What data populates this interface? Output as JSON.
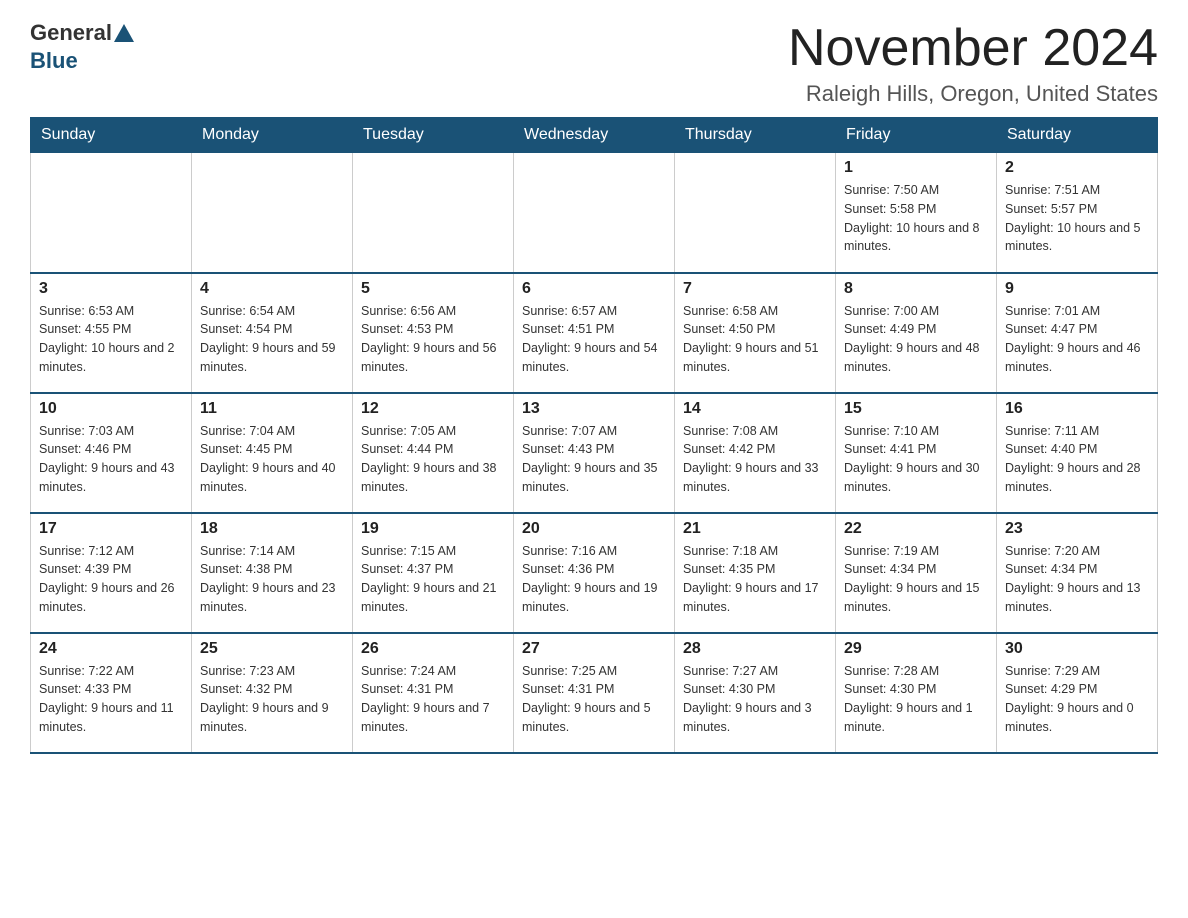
{
  "header": {
    "logo_general": "General",
    "logo_blue": "Blue",
    "month_title": "November 2024",
    "location": "Raleigh Hills, Oregon, United States"
  },
  "weekdays": [
    "Sunday",
    "Monday",
    "Tuesday",
    "Wednesday",
    "Thursday",
    "Friday",
    "Saturday"
  ],
  "weeks": [
    {
      "days": [
        {
          "number": "",
          "info": ""
        },
        {
          "number": "",
          "info": ""
        },
        {
          "number": "",
          "info": ""
        },
        {
          "number": "",
          "info": ""
        },
        {
          "number": "",
          "info": ""
        },
        {
          "number": "1",
          "info": "Sunrise: 7:50 AM\nSunset: 5:58 PM\nDaylight: 10 hours and 8 minutes."
        },
        {
          "number": "2",
          "info": "Sunrise: 7:51 AM\nSunset: 5:57 PM\nDaylight: 10 hours and 5 minutes."
        }
      ]
    },
    {
      "days": [
        {
          "number": "3",
          "info": "Sunrise: 6:53 AM\nSunset: 4:55 PM\nDaylight: 10 hours and 2 minutes."
        },
        {
          "number": "4",
          "info": "Sunrise: 6:54 AM\nSunset: 4:54 PM\nDaylight: 9 hours and 59 minutes."
        },
        {
          "number": "5",
          "info": "Sunrise: 6:56 AM\nSunset: 4:53 PM\nDaylight: 9 hours and 56 minutes."
        },
        {
          "number": "6",
          "info": "Sunrise: 6:57 AM\nSunset: 4:51 PM\nDaylight: 9 hours and 54 minutes."
        },
        {
          "number": "7",
          "info": "Sunrise: 6:58 AM\nSunset: 4:50 PM\nDaylight: 9 hours and 51 minutes."
        },
        {
          "number": "8",
          "info": "Sunrise: 7:00 AM\nSunset: 4:49 PM\nDaylight: 9 hours and 48 minutes."
        },
        {
          "number": "9",
          "info": "Sunrise: 7:01 AM\nSunset: 4:47 PM\nDaylight: 9 hours and 46 minutes."
        }
      ]
    },
    {
      "days": [
        {
          "number": "10",
          "info": "Sunrise: 7:03 AM\nSunset: 4:46 PM\nDaylight: 9 hours and 43 minutes."
        },
        {
          "number": "11",
          "info": "Sunrise: 7:04 AM\nSunset: 4:45 PM\nDaylight: 9 hours and 40 minutes."
        },
        {
          "number": "12",
          "info": "Sunrise: 7:05 AM\nSunset: 4:44 PM\nDaylight: 9 hours and 38 minutes."
        },
        {
          "number": "13",
          "info": "Sunrise: 7:07 AM\nSunset: 4:43 PM\nDaylight: 9 hours and 35 minutes."
        },
        {
          "number": "14",
          "info": "Sunrise: 7:08 AM\nSunset: 4:42 PM\nDaylight: 9 hours and 33 minutes."
        },
        {
          "number": "15",
          "info": "Sunrise: 7:10 AM\nSunset: 4:41 PM\nDaylight: 9 hours and 30 minutes."
        },
        {
          "number": "16",
          "info": "Sunrise: 7:11 AM\nSunset: 4:40 PM\nDaylight: 9 hours and 28 minutes."
        }
      ]
    },
    {
      "days": [
        {
          "number": "17",
          "info": "Sunrise: 7:12 AM\nSunset: 4:39 PM\nDaylight: 9 hours and 26 minutes."
        },
        {
          "number": "18",
          "info": "Sunrise: 7:14 AM\nSunset: 4:38 PM\nDaylight: 9 hours and 23 minutes."
        },
        {
          "number": "19",
          "info": "Sunrise: 7:15 AM\nSunset: 4:37 PM\nDaylight: 9 hours and 21 minutes."
        },
        {
          "number": "20",
          "info": "Sunrise: 7:16 AM\nSunset: 4:36 PM\nDaylight: 9 hours and 19 minutes."
        },
        {
          "number": "21",
          "info": "Sunrise: 7:18 AM\nSunset: 4:35 PM\nDaylight: 9 hours and 17 minutes."
        },
        {
          "number": "22",
          "info": "Sunrise: 7:19 AM\nSunset: 4:34 PM\nDaylight: 9 hours and 15 minutes."
        },
        {
          "number": "23",
          "info": "Sunrise: 7:20 AM\nSunset: 4:34 PM\nDaylight: 9 hours and 13 minutes."
        }
      ]
    },
    {
      "days": [
        {
          "number": "24",
          "info": "Sunrise: 7:22 AM\nSunset: 4:33 PM\nDaylight: 9 hours and 11 minutes."
        },
        {
          "number": "25",
          "info": "Sunrise: 7:23 AM\nSunset: 4:32 PM\nDaylight: 9 hours and 9 minutes."
        },
        {
          "number": "26",
          "info": "Sunrise: 7:24 AM\nSunset: 4:31 PM\nDaylight: 9 hours and 7 minutes."
        },
        {
          "number": "27",
          "info": "Sunrise: 7:25 AM\nSunset: 4:31 PM\nDaylight: 9 hours and 5 minutes."
        },
        {
          "number": "28",
          "info": "Sunrise: 7:27 AM\nSunset: 4:30 PM\nDaylight: 9 hours and 3 minutes."
        },
        {
          "number": "29",
          "info": "Sunrise: 7:28 AM\nSunset: 4:30 PM\nDaylight: 9 hours and 1 minute."
        },
        {
          "number": "30",
          "info": "Sunrise: 7:29 AM\nSunset: 4:29 PM\nDaylight: 9 hours and 0 minutes."
        }
      ]
    }
  ]
}
